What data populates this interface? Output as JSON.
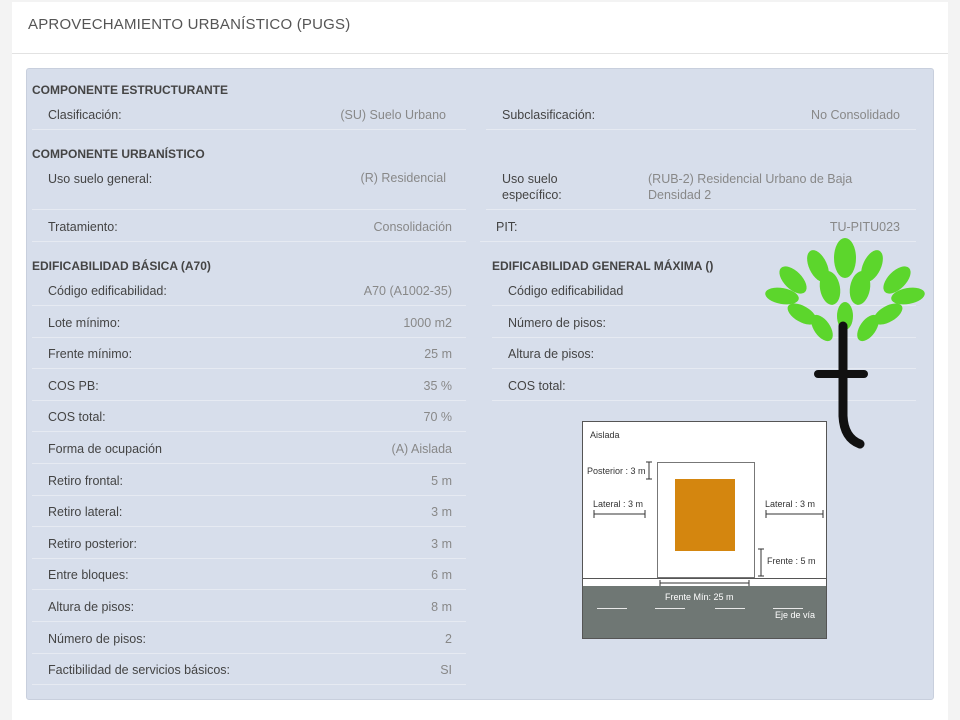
{
  "header": {
    "title": "APROVECHAMIENTO URBANÍSTICO (PUGS)"
  },
  "componente_estructurante": {
    "title": "COMPONENTE ESTRUCTURANTE",
    "clasificacion": {
      "label": "Clasificación:",
      "value": "(SU) Suelo Urbano"
    },
    "subclasificacion": {
      "label": "Subclasificación:",
      "value": "No Consolidado"
    }
  },
  "componente_urbanistico": {
    "title": "COMPONENTE URBANÍSTICO",
    "uso_general": {
      "label": "Uso suelo general:",
      "value": "(R) Residencial"
    },
    "uso_especifico": {
      "label_line1": "Uso suelo",
      "label_line2": "específico:",
      "value_line1": "(RUB-2) Residencial Urbano de Baja",
      "value_line2": "Densidad 2"
    },
    "tratamiento": {
      "label": "Tratamiento:",
      "value": "Consolidación"
    },
    "pit": {
      "label": "PIT:",
      "value": "TU-PITU023"
    }
  },
  "edificabilidad_basica": {
    "title": "EDIFICABILIDAD BÁSICA (A70)",
    "rows": [
      {
        "label": "Código edificabilidad:",
        "value": "A70 (A1002-35)"
      },
      {
        "label": "Lote mínimo:",
        "value": "1000 m2"
      },
      {
        "label": "Frente mínimo:",
        "value": "25 m"
      },
      {
        "label": "COS PB:",
        "value": "35 %"
      },
      {
        "label": "COS total:",
        "value": "70 %"
      },
      {
        "label": "Forma de ocupación",
        "value": "(A) Aislada"
      },
      {
        "label": "Retiro frontal:",
        "value": "5 m"
      },
      {
        "label": "Retiro lateral:",
        "value": "3 m"
      },
      {
        "label": "Retiro posterior:",
        "value": "3 m"
      },
      {
        "label": "Entre bloques:",
        "value": "6 m"
      },
      {
        "label": "Altura de pisos:",
        "value": "8 m"
      },
      {
        "label": "Número de pisos:",
        "value": "2"
      },
      {
        "label": "Factibilidad de servicios básicos:",
        "value": "SI"
      }
    ]
  },
  "edificabilidad_maxima": {
    "title": "EDIFICABILIDAD GENERAL MÁXIMA ()",
    "rows": [
      {
        "label": "Código edificabilidad",
        "value": ""
      },
      {
        "label": "Número de pisos:",
        "value": ""
      },
      {
        "label": "Altura de pisos:",
        "value": ""
      },
      {
        "label": "COS total:",
        "value": ""
      }
    ]
  },
  "diagram": {
    "title": "Aislada",
    "posterior": "Posterior : 3 m",
    "lateral_left": "Lateral : 3 m",
    "lateral_right": "Lateral : 3 m",
    "frente": "Frente : 5 m",
    "frente_min": "Frente Mín: 25 m",
    "eje_via": "Eje de vía",
    "colors": {
      "building": "#d4860f",
      "road": "#6f7774"
    }
  },
  "colors": {
    "panel": "#d7deeb",
    "logo_leaf": "#5cd62c",
    "logo_trunk": "#111111"
  }
}
